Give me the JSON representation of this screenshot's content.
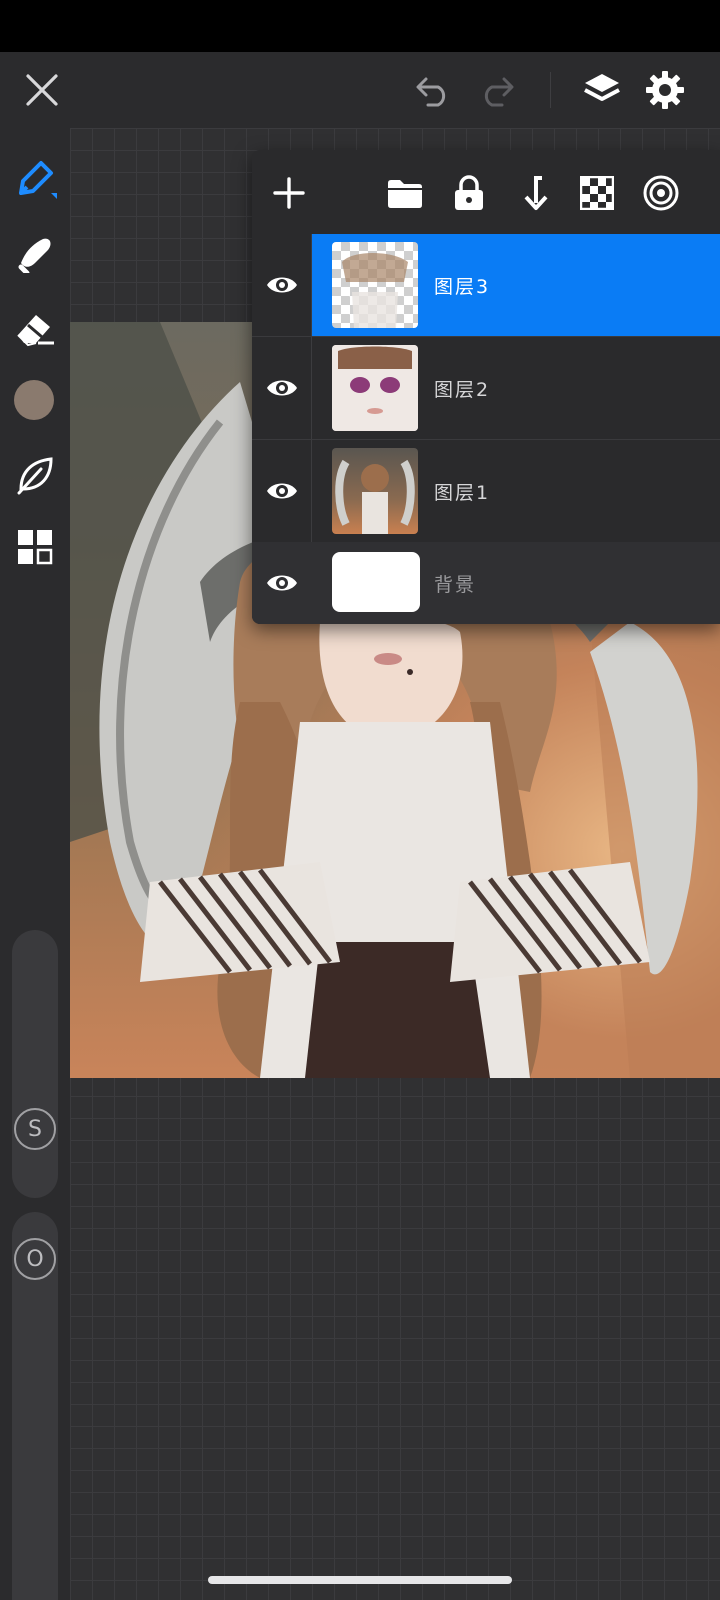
{
  "app": {
    "top_bar": {
      "close_icon": "close-icon",
      "undo_icon": "undo-icon",
      "redo_icon": "redo-icon",
      "layers_icon": "layers-icon",
      "settings_icon": "gear-icon"
    },
    "tools": [
      {
        "name": "brush-tool",
        "icon": "pen-icon",
        "active": true
      },
      {
        "name": "smudge-tool",
        "icon": "smudge-icon",
        "active": false
      },
      {
        "name": "eraser-tool",
        "icon": "eraser-icon",
        "active": false
      },
      {
        "name": "color-swatch",
        "icon": "color-swatch",
        "color": "#8a7a6e"
      },
      {
        "name": "leaf-tool",
        "icon": "leaf-icon",
        "active": false
      },
      {
        "name": "gallery-tool",
        "icon": "grid-icon",
        "active": false
      }
    ],
    "side_controls": {
      "size_label": "S",
      "opacity_label": "O"
    },
    "layers_panel": {
      "toolbar_icons": [
        "add-icon",
        "folder-icon",
        "lock-icon",
        "merge-down-icon",
        "checker-icon",
        "target-icon"
      ],
      "layers": [
        {
          "name": "图层3",
          "visible": true,
          "selected": true
        },
        {
          "name": "图层2",
          "visible": true,
          "selected": false
        },
        {
          "name": "图层1",
          "visible": true,
          "selected": false
        },
        {
          "name": "背景",
          "visible": true,
          "selected": false
        }
      ]
    },
    "colors": {
      "accent": "#0a7cf5",
      "toolbar_bg": "#2b2b2d",
      "panel_bg": "#2a2a2c"
    }
  }
}
